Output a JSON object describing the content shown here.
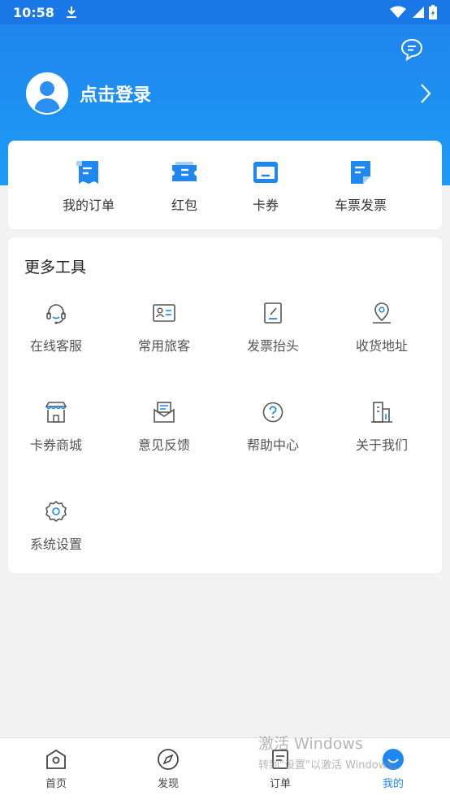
{
  "status_bar": {
    "time": "10:58"
  },
  "profile": {
    "login_label": "点击登录"
  },
  "quick_actions": [
    {
      "label": "我的订单",
      "icon": "receipt-icon"
    },
    {
      "label": "红包",
      "icon": "coupon-icon"
    },
    {
      "label": "卡券",
      "icon": "card-icon"
    },
    {
      "label": "车票发票",
      "icon": "invoice-icon"
    }
  ],
  "tools": {
    "title": "更多工具",
    "items": [
      {
        "label": "在线客服",
        "icon": "headset-icon"
      },
      {
        "label": "常用旅客",
        "icon": "id-card-icon"
      },
      {
        "label": "发票抬头",
        "icon": "document-edit-icon"
      },
      {
        "label": "收货地址",
        "icon": "location-pin-icon"
      },
      {
        "label": "卡券商城",
        "icon": "store-icon"
      },
      {
        "label": "意见反馈",
        "icon": "feedback-mail-icon"
      },
      {
        "label": "帮助中心",
        "icon": "help-circle-icon"
      },
      {
        "label": "关于我们",
        "icon": "building-icon"
      },
      {
        "label": "系统设置",
        "icon": "gear-icon"
      }
    ]
  },
  "tabbar": {
    "items": [
      {
        "label": "首页",
        "icon": "home-icon"
      },
      {
        "label": "发现",
        "icon": "compass-icon"
      },
      {
        "label": "订单",
        "icon": "order-icon"
      },
      {
        "label": "我的",
        "icon": "smile-icon"
      }
    ],
    "active_index": 3
  },
  "watermark": {
    "line1": "激活 Windows",
    "line2": "转到\"设置\"以激活 Windows。"
  },
  "colors": {
    "primary": "#1e88f0",
    "header_top": "#1f85ef",
    "background": "#f2f2f2"
  }
}
